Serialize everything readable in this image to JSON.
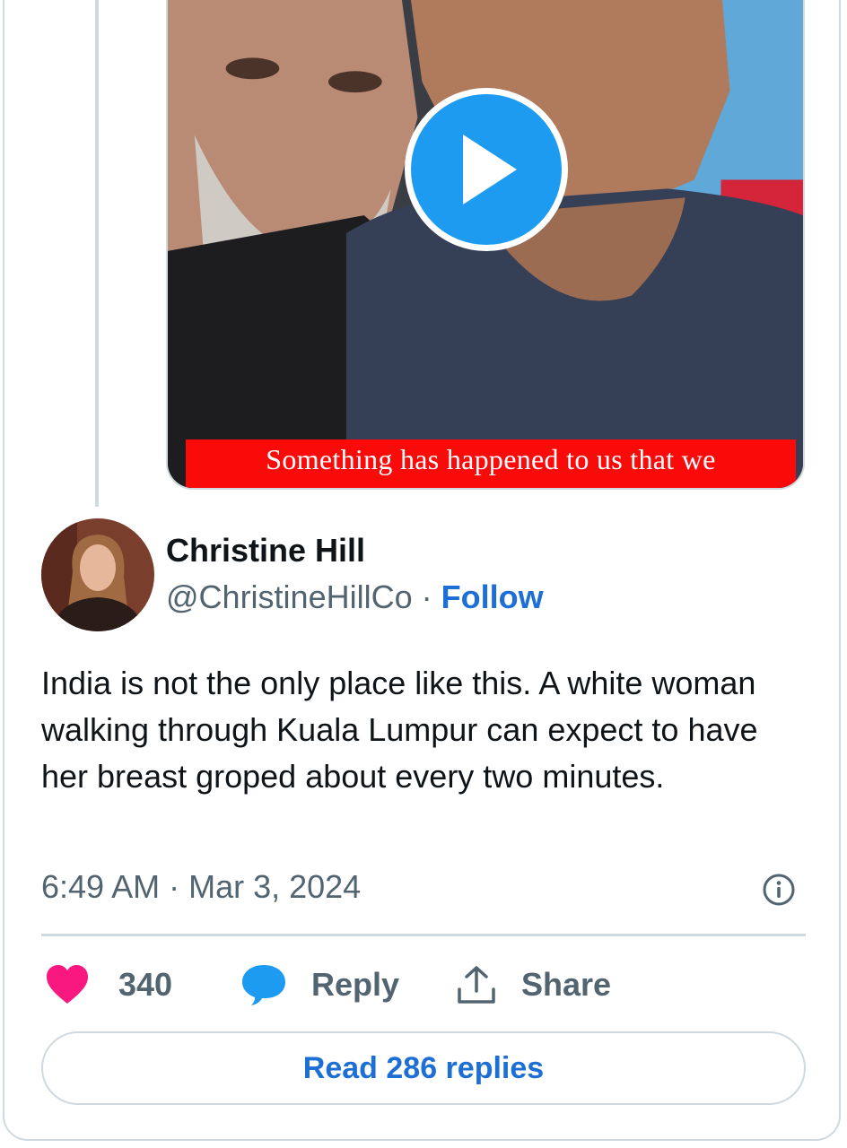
{
  "media": {
    "caption": "Something has happened to us that we",
    "play_icon": "play-icon"
  },
  "author": {
    "name": "Christine Hill",
    "handle": "@ChristineHillCo",
    "separator": "·",
    "follow_label": "Follow"
  },
  "tweet": {
    "text": "India is not the only place like this. A white woman walking through Kuala Lumpur can expect to have her breast groped about every two minutes.",
    "timestamp": "6:49 AM · Mar 3, 2024"
  },
  "actions": {
    "like_count": "340",
    "reply_label": "Reply",
    "share_label": "Share"
  },
  "read_replies_label": "Read 286 replies",
  "colors": {
    "like": "#f91880",
    "reply": "#1d9bf0",
    "link": "#1d6fd6",
    "muted": "#536471",
    "border": "#cfd9de",
    "caption_bg": "#fb0a0a"
  }
}
